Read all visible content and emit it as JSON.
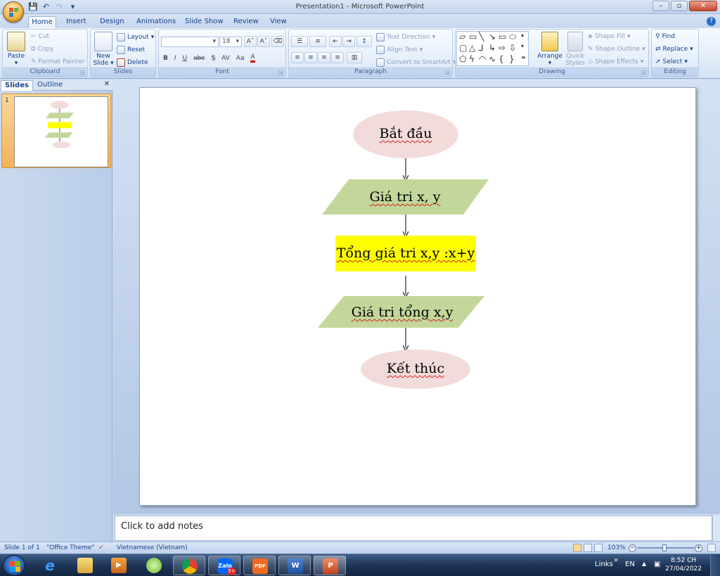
{
  "window": {
    "title": "Presentation1 - Microsoft PowerPoint",
    "controls": [
      "–",
      "▫",
      "✕"
    ]
  },
  "ribbon": {
    "tabs": [
      "Home",
      "Insert",
      "Design",
      "Animations",
      "Slide Show",
      "Review",
      "View"
    ],
    "active_tab": "Home",
    "clipboard": {
      "label": "Clipboard",
      "paste": "Paste",
      "cut": "Cut",
      "copy": "Copy",
      "format_painter": "Format Painter"
    },
    "slides": {
      "label": "Slides",
      "new_slide": "New Slide",
      "layout": "Layout",
      "reset": "Reset",
      "delete": "Delete"
    },
    "font": {
      "label": "Font",
      "size": "18",
      "bold": "B",
      "italic": "I",
      "underline": "U",
      "strike": "abc",
      "shadow": "S",
      "spacing": "AV",
      "case": "Aa",
      "color": "A"
    },
    "paragraph": {
      "label": "Paragraph",
      "text_direction": "Text Direction",
      "align_text": "Align Text",
      "smartart": "Convert to SmartArt"
    },
    "drawing": {
      "label": "Drawing",
      "arrange": "Arrange",
      "quick_styles": "Quick Styles",
      "shape_fill": "Shape Fill",
      "shape_outline": "Shape Outline",
      "shape_effects": "Shape Effects"
    },
    "editing": {
      "label": "Editing",
      "find": "Find",
      "replace": "Replace",
      "select": "Select"
    }
  },
  "left_pane": {
    "tabs": [
      "Slides",
      "Outline"
    ],
    "active_tab": "Slides",
    "slide_number": "1"
  },
  "flowchart": {
    "nodes": [
      {
        "text": "Bắt đầu",
        "shape": "ellipse",
        "fill": "#f2dcdb"
      },
      {
        "text": "Giá tri x, y",
        "shape": "parallelogram",
        "fill": "#c4d79b"
      },
      {
        "text": "Tổng giá tri x,y :x+y",
        "shape": "rectangle",
        "fill": "#ffff00"
      },
      {
        "text": "Giá tri tổng x,y",
        "shape": "parallelogram",
        "fill": "#c4d79b"
      },
      {
        "text": "Kết thúc",
        "shape": "ellipse",
        "fill": "#f2dcdb"
      }
    ]
  },
  "notes": {
    "placeholder": "Click to add notes"
  },
  "status": {
    "slide": "Slide 1 of 1",
    "theme": "\"Office Theme\"",
    "language": "Vietnamese (Vietnam)",
    "zoom": "103%"
  },
  "taskbar": {
    "apps": [
      "ie-icon",
      "explorer-icon",
      "media-player-icon",
      "coccoc-icon",
      "chrome-icon",
      "zalo-icon",
      "pdf-icon",
      "word-icon",
      "powerpoint-icon"
    ],
    "zalo_label": "Zalo",
    "zalo_badge": "5+",
    "pdf_label": "PDF",
    "word_label": "W",
    "ppt_label": "P",
    "links": "Links",
    "lang": "EN",
    "time": "8:52 CH",
    "date": "27/04/2022"
  }
}
